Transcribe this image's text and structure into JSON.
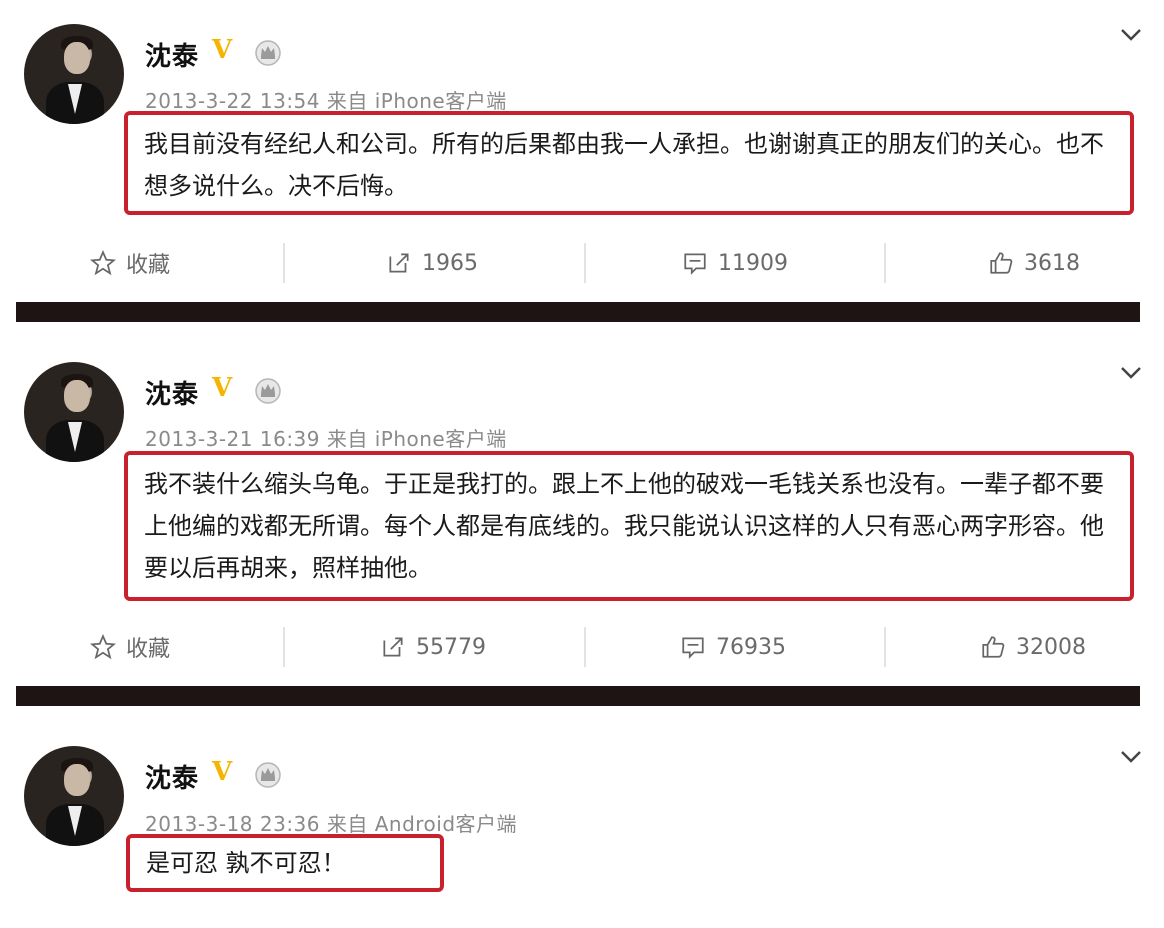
{
  "posts": [
    {
      "username": "沈泰",
      "verified_badge": "V",
      "meta": "2013-3-22 13:54 来自 iPhone客户端",
      "content": "我目前没有经纪人和公司。所有的后果都由我一人承担。也谢谢真正的朋友们的关心。也不想多说什么。决不后悔。",
      "actions": {
        "favorite": "收藏",
        "repost": "1965",
        "comment": "11909",
        "like": "3618"
      }
    },
    {
      "username": "沈泰",
      "verified_badge": "V",
      "meta": "2013-3-21 16:39 来自 iPhone客户端",
      "content": "我不装什么缩头乌龟。于正是我打的。跟上不上他的破戏一毛钱关系也没有。一辈子都不要上他编的戏都无所谓。每个人都是有底线的。我只能说认识这样的人只有恶心两字形容。他要以后再胡来，照样抽他。",
      "actions": {
        "favorite": "收藏",
        "repost": "55779",
        "comment": "76935",
        "like": "32008"
      }
    },
    {
      "username": "沈泰",
      "verified_badge": "V",
      "meta": "2013-3-18 23:36 来自 Android客户端",
      "content": "是可忍 孰不可忍！"
    }
  ],
  "colors": {
    "highlight_border": "#c8202c",
    "verified": "#f4b400",
    "separator": "#1e1414",
    "meta_text": "#8a8a8a"
  },
  "icons": [
    "avatar",
    "verified-v-icon",
    "crown-icon",
    "chevron-down-icon",
    "star-icon",
    "repost-icon",
    "comment-icon",
    "thumbs-up-icon"
  ]
}
